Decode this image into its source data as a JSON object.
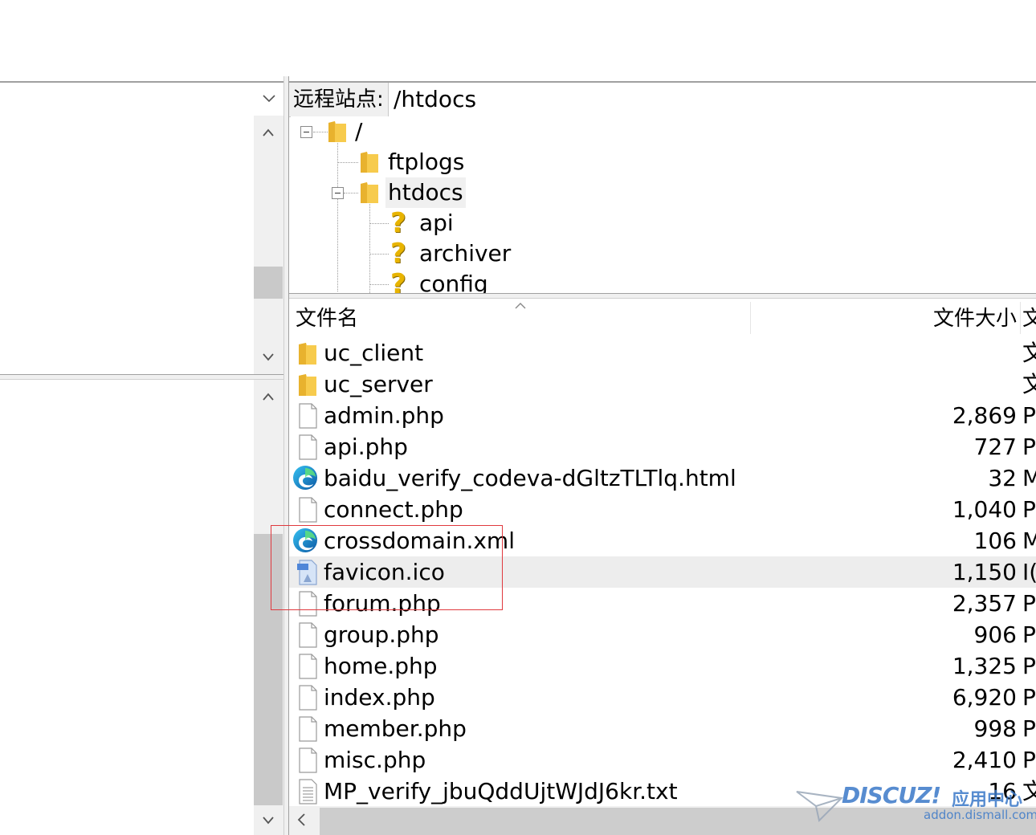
{
  "remote": {
    "path_label": "远程站点:",
    "path_value": "/htdocs"
  },
  "tree": {
    "items": [
      {
        "label": "/",
        "icon": "folder-icon"
      },
      {
        "label": "ftplogs",
        "icon": "folder-icon"
      },
      {
        "label": "htdocs",
        "icon": "folder-icon"
      },
      {
        "label": "api",
        "icon": "question-folder-icon"
      },
      {
        "label": "archiver",
        "icon": "question-folder-icon"
      },
      {
        "label": "config",
        "icon": "question-folder-icon"
      }
    ]
  },
  "file_list": {
    "columns": {
      "name": "文件名",
      "size": "文件大小",
      "type": "文"
    },
    "rows": [
      {
        "name": "uc_client",
        "size": "",
        "type": "文",
        "icon": "folder-icon"
      },
      {
        "name": "uc_server",
        "size": "",
        "type": "文",
        "icon": "folder-icon"
      },
      {
        "name": "admin.php",
        "size": "2,869",
        "type": "P",
        "icon": "file-icon"
      },
      {
        "name": "api.php",
        "size": "727",
        "type": "P",
        "icon": "file-icon"
      },
      {
        "name": "baidu_verify_codeva-dGltzTLTlq.html",
        "size": "32",
        "type": "M",
        "icon": "edge-icon"
      },
      {
        "name": "connect.php",
        "size": "1,040",
        "type": "P",
        "icon": "file-icon"
      },
      {
        "name": "crossdomain.xml",
        "size": "106",
        "type": "M",
        "icon": "edge-icon"
      },
      {
        "name": "favicon.ico",
        "size": "1,150",
        "type": "I(",
        "icon": "ico-file-icon"
      },
      {
        "name": "forum.php",
        "size": "2,357",
        "type": "P",
        "icon": "file-icon"
      },
      {
        "name": "group.php",
        "size": "906",
        "type": "P",
        "icon": "file-icon"
      },
      {
        "name": "home.php",
        "size": "1,325",
        "type": "P",
        "icon": "file-icon"
      },
      {
        "name": "index.php",
        "size": "6,920",
        "type": "P",
        "icon": "file-icon"
      },
      {
        "name": "member.php",
        "size": "998",
        "type": "P",
        "icon": "file-icon"
      },
      {
        "name": "misc.php",
        "size": "2,410",
        "type": "P",
        "icon": "file-icon"
      },
      {
        "name": "MP_verify_jbuQddUjtWJdJ6kr.txt",
        "size": "16",
        "type": "文",
        "icon": "text-file-icon"
      }
    ]
  },
  "watermark": {
    "brand": "DISCUZ!",
    "sub": "应用中心",
    "url": "addon.dismall.com"
  },
  "colors": {
    "highlight_box": "#e0393e",
    "selected_row": "#ededed",
    "folder": "#f5c842",
    "question": "#e8b400"
  }
}
